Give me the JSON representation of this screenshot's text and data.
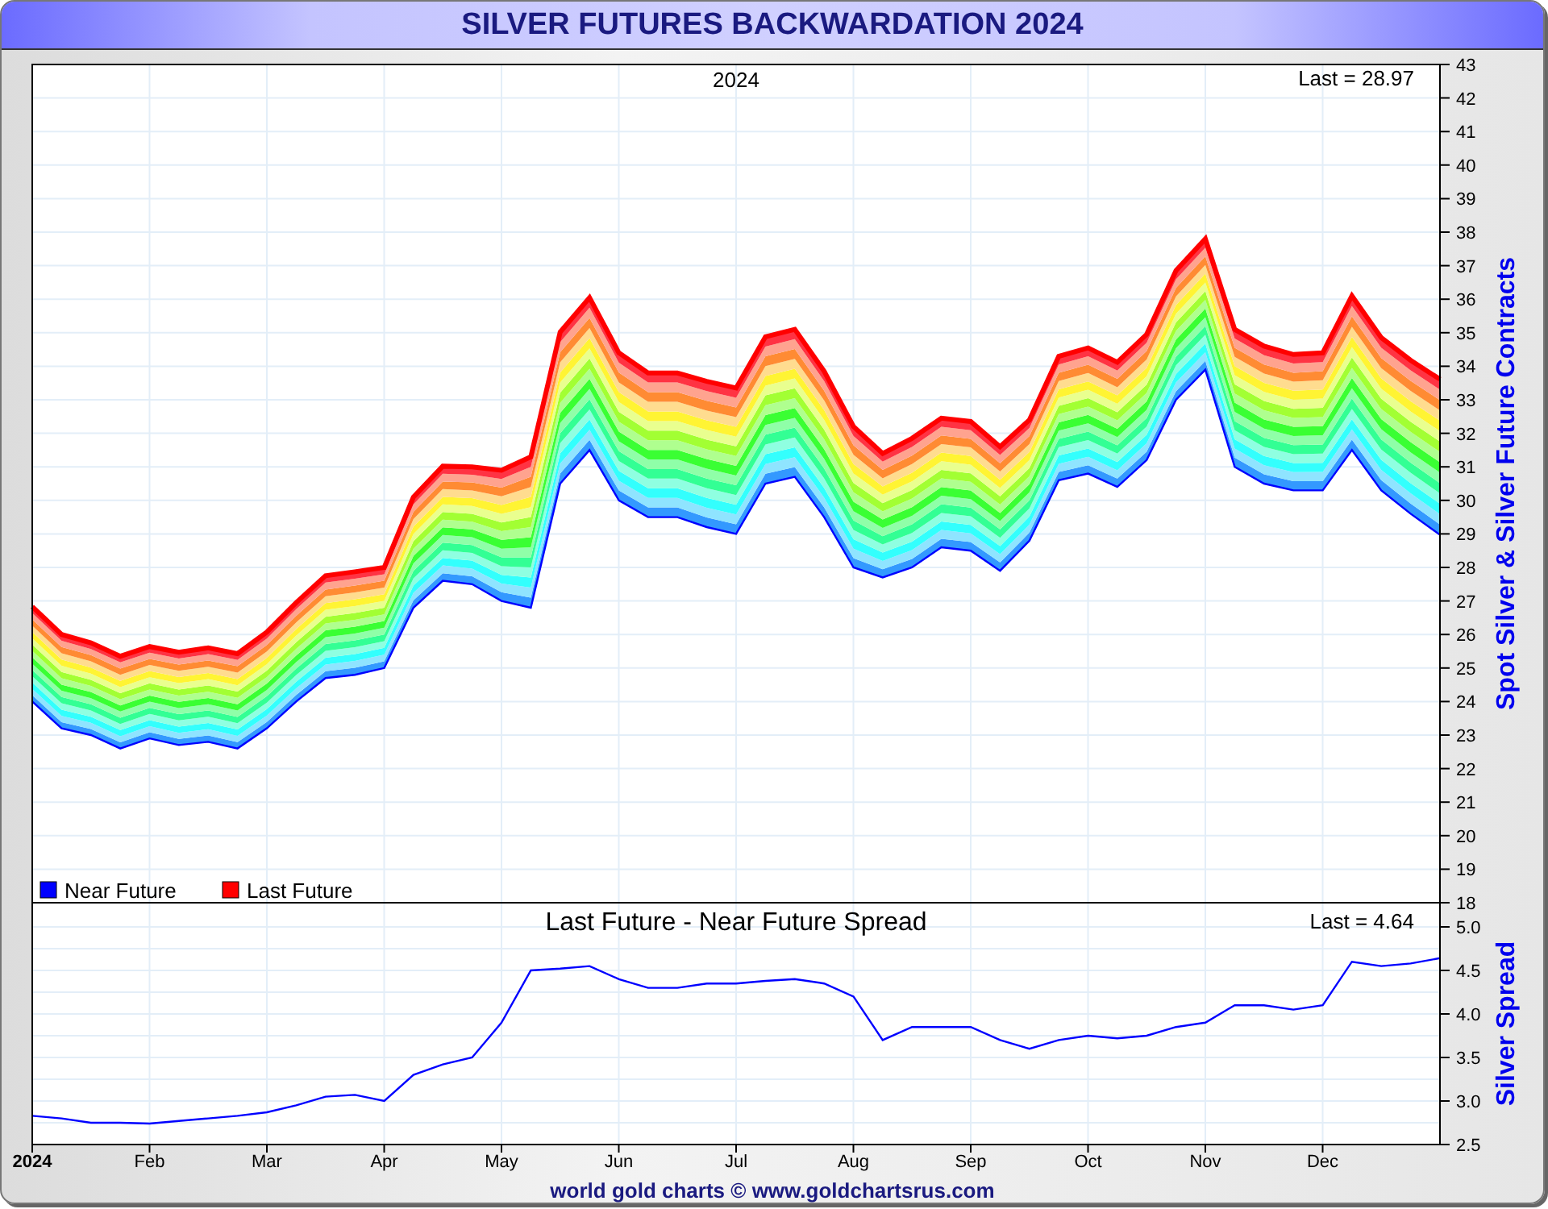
{
  "title": "SILVER FUTURES BACKWARDATION 2024",
  "charts": [
    {
      "chart_data": {
        "type": "line",
        "title": "2024",
        "ylabel": "Spot Silver & Silver Future Contracts",
        "annotations": [
          "Last = 28.97"
        ],
        "grid": true,
        "legend": "lower left",
        "ylim": [
          18,
          43
        ],
        "yticks": [
          {
            "value": 18,
            "label": "18"
          },
          {
            "value": 19,
            "label": "19"
          },
          {
            "value": 20,
            "label": "20"
          },
          {
            "value": 21,
            "label": "21"
          },
          {
            "value": 22,
            "label": "22"
          },
          {
            "value": 23,
            "label": "23"
          },
          {
            "value": 24,
            "label": "24"
          },
          {
            "value": 25,
            "label": "25"
          },
          {
            "value": 26,
            "label": "26"
          },
          {
            "value": 27,
            "label": "27"
          },
          {
            "value": 28,
            "label": "28"
          },
          {
            "value": 29,
            "label": "29"
          },
          {
            "value": 30,
            "label": "30"
          },
          {
            "value": 31,
            "label": "31"
          },
          {
            "value": 32,
            "label": "32"
          },
          {
            "value": 33,
            "label": "33"
          },
          {
            "value": 34,
            "label": "34"
          },
          {
            "value": 35,
            "label": "35"
          },
          {
            "value": 36,
            "label": "36"
          },
          {
            "value": 37,
            "label": "37"
          },
          {
            "value": 38,
            "label": "38"
          },
          {
            "value": 39,
            "label": "39"
          },
          {
            "value": 40,
            "label": "40"
          },
          {
            "value": 41,
            "label": "41"
          },
          {
            "value": 42,
            "label": "42"
          },
          {
            "value": 43,
            "label": "43"
          }
        ],
        "categories": [
          null,
          null,
          null,
          null,
          null,
          null,
          null,
          null,
          null,
          null,
          null,
          null,
          null,
          null,
          null,
          null,
          null,
          null,
          null,
          null,
          null,
          null,
          null,
          null,
          null,
          null,
          null,
          null,
          null,
          null,
          null,
          null,
          null,
          null,
          null,
          null,
          null,
          null,
          null,
          null,
          null,
          null,
          null,
          null,
          null,
          null,
          null,
          null,
          null
        ],
        "series": [
          {
            "name": "Near Future",
            "color": "#0000ff",
            "values": [
              24.0,
              23.2,
              23.0,
              22.6,
              22.9,
              22.7,
              22.8,
              22.6,
              23.2,
              24.0,
              24.7,
              24.8,
              25.0,
              26.8,
              27.6,
              27.5,
              27.0,
              26.8,
              30.5,
              31.5,
              30.0,
              29.5,
              29.5,
              29.2,
              29.0,
              30.5,
              30.7,
              29.5,
              28.0,
              27.7,
              28.0,
              28.6,
              28.5,
              27.9,
              28.8,
              30.6,
              30.8,
              30.4,
              31.2,
              33.0,
              33.9,
              31.0,
              30.5,
              30.3,
              30.3,
              31.5,
              30.3,
              29.6,
              28.97
            ]
          },
          {
            "name": "Last Future",
            "color": "#ff0000",
            "values": [
              26.83,
              26.0,
              25.75,
              25.35,
              25.64,
              25.47,
              25.6,
              25.43,
              26.07,
              26.95,
              27.75,
              27.87,
              28.0,
              30.1,
              31.02,
              31.0,
              30.9,
              31.3,
              35.02,
              36.05,
              34.4,
              33.8,
              33.8,
              33.55,
              33.35,
              34.88,
              35.1,
              33.85,
              32.2,
              31.4,
              31.85,
              32.45,
              32.35,
              31.6,
              32.4,
              34.3,
              34.55,
              34.12,
              34.95,
              36.85,
              37.8,
              35.1,
              34.6,
              34.35,
              34.4,
              36.1,
              34.85,
              34.18,
              33.61
            ]
          }
        ]
      }
    },
    {
      "chart_data": {
        "type": "line",
        "title": "Last Future - Near Future Spread",
        "ylabel": "Silver Spread",
        "annotations": [
          "Last = 4.64"
        ],
        "grid": true,
        "ylim": [
          2.5,
          5.0
        ],
        "yticks": [
          {
            "value": 2.5,
            "label": "2.5"
          },
          {
            "value": 3.0,
            "label": "3.0"
          },
          {
            "value": 3.5,
            "label": "3.5"
          },
          {
            "value": 4.0,
            "label": "4.0"
          },
          {
            "value": 4.5,
            "label": "4.5"
          },
          {
            "value": 5.0,
            "label": "5.0"
          }
        ],
        "categories": [
          "2024",
          null,
          null,
          null,
          "Feb",
          null,
          null,
          null,
          "Mar",
          null,
          null,
          null,
          "Apr",
          null,
          null,
          null,
          "May",
          null,
          null,
          null,
          "Jun",
          null,
          null,
          null,
          "Jul",
          null,
          null,
          null,
          "Aug",
          null,
          null,
          null,
          "Sep",
          null,
          null,
          null,
          "Oct",
          null,
          null,
          null,
          "Nov",
          null,
          null,
          null,
          "Dec",
          null,
          null,
          null,
          null
        ],
        "series": [
          {
            "color": "#0000ff",
            "values": [
              2.83,
              2.8,
              2.75,
              2.75,
              2.74,
              2.77,
              2.8,
              2.83,
              2.87,
              2.95,
              3.05,
              3.07,
              3.0,
              3.3,
              3.42,
              3.5,
              3.9,
              4.5,
              4.52,
              4.55,
              4.4,
              4.3,
              4.3,
              4.35,
              4.35,
              4.38,
              4.4,
              4.35,
              4.2,
              3.7,
              3.85,
              3.85,
              3.85,
              3.7,
              3.6,
              3.7,
              3.75,
              3.72,
              3.75,
              3.85,
              3.9,
              4.1,
              4.1,
              4.05,
              4.1,
              4.6,
              4.55,
              4.58,
              4.64
            ]
          }
        ]
      }
    }
  ],
  "footer": "world gold charts © www.goldchartsrus.com"
}
